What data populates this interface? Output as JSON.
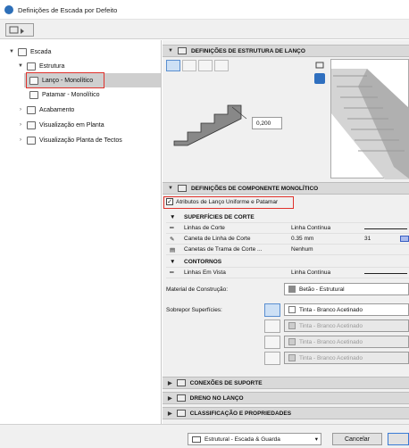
{
  "window": {
    "title": "Definições de Escada por Defeito"
  },
  "tree": {
    "escada": "Escada",
    "estrutura": "Estrutura",
    "lanco": "Lanço - Monolítico",
    "patamar": "Patamar - Monolítico",
    "acabamento": "Acabamento",
    "vis_planta": "Visualização em Planta",
    "vis_tectos": "Visualização Planta de Tectos"
  },
  "estrutura_section": {
    "title": "DEFINIÇÕES DE ESTRUTURA DE LANÇO",
    "thickness_value": "0,200"
  },
  "componente_section": {
    "title": "DEFINIÇÕES DE COMPONENTE MONOLÍTICO",
    "checkbox_label": "Atributos de Lanço Uniforme e Patamar",
    "group_corte": "SUPERFÍCIES DE CORTE",
    "row_linhas_corte": {
      "label": "Linhas de Corte",
      "value": "Linha Contínua"
    },
    "row_caneta": {
      "label": "Caneta de Linha de Corte",
      "value": "0.35 mm",
      "num": "31"
    },
    "row_trama": {
      "label": "Canetas de Trama de Corte ...",
      "value": "Nenhum"
    },
    "group_contornos": "CONTORNOS",
    "row_vista": {
      "label": "Linhas Em Vista",
      "value": "Linha Contínua"
    },
    "material_label": "Material de Construção:",
    "material_value": "Betão - Estrutural",
    "sobrepor_label": "Sobrepor Superfícies:",
    "surface_1": "Tinta - Branco Acetinado",
    "surface_2": "Tinta - Branco Acetinado",
    "surface_3": "Tinta - Branco Acetinado",
    "surface_4": "Tinta - Branco Acetinado"
  },
  "collapsed_sections": {
    "suporte": "CONEXÕES DE SUPORTE",
    "dreno": "DRENO NO LANÇO",
    "classificacao": "CLASSIFICAÇÃO E PROPRIEDADES"
  },
  "footer": {
    "layer": "Estrutural - Escada & Guarda",
    "cancel": "Cancelar"
  },
  "colors": {
    "highlight": "#e0312b",
    "selection": "#cfcfcf",
    "section_bg": "#d9d9d9"
  }
}
